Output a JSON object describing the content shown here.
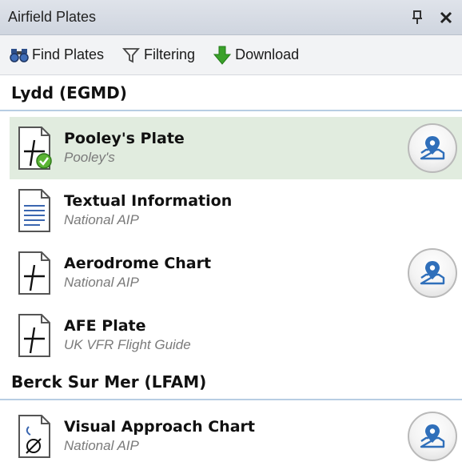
{
  "panel": {
    "title": "Airfield Plates",
    "pin_icon": "pin-icon",
    "close_icon": "close-icon"
  },
  "toolbar": {
    "find_label": "Find Plates",
    "filter_label": "Filtering",
    "download_label": "Download"
  },
  "groups": [
    {
      "header": "Lydd (EGMD)",
      "items": [
        {
          "name": "Pooley's Plate",
          "source": "Pooley's",
          "icon": "plate-downloaded-icon",
          "selected": true,
          "map_button": true
        },
        {
          "name": "Textual Information",
          "source": "National AIP",
          "icon": "text-document-icon",
          "selected": false,
          "map_button": false
        },
        {
          "name": "Aerodrome Chart",
          "source": "National AIP",
          "icon": "plate-icon",
          "selected": false,
          "map_button": true
        },
        {
          "name": "AFE Plate",
          "source": "UK VFR Flight Guide",
          "icon": "plate-icon",
          "selected": false,
          "map_button": false
        }
      ]
    },
    {
      "header": "Berck Sur Mer (LFAM)",
      "items": [
        {
          "name": "Visual Approach Chart",
          "source": "National AIP",
          "icon": "approach-chart-icon",
          "selected": false,
          "map_button": true
        }
      ]
    }
  ],
  "colors": {
    "selected_row": "#e1ecdf",
    "header_rule": "#b7cde3",
    "map_pin": "#2f6fba",
    "download_arrow": "#3aa12a"
  }
}
